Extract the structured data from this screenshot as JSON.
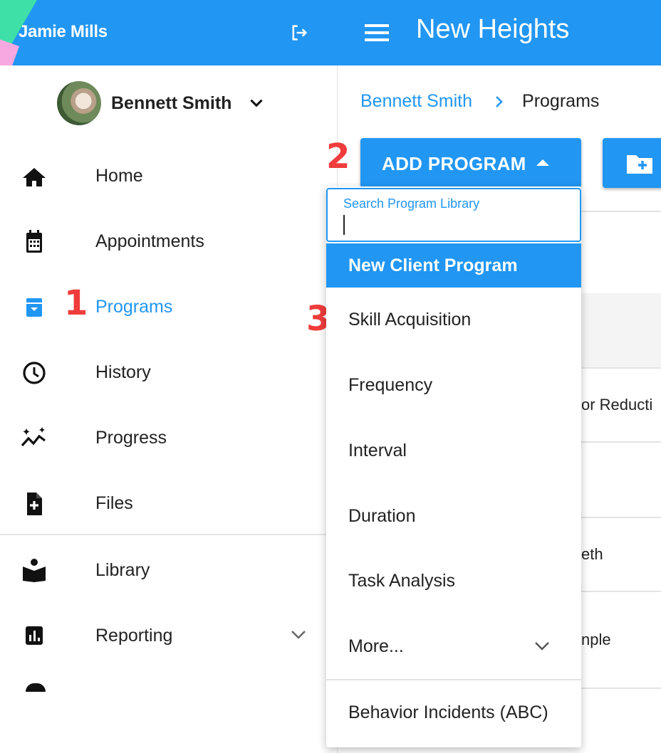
{
  "header": {
    "user_name": "Jamie Mills",
    "app_title": "New Heights"
  },
  "sidebar": {
    "client_name": "Bennett Smith",
    "items": [
      {
        "label": "Home",
        "icon": "home-icon"
      },
      {
        "label": "Appointments",
        "icon": "calendar-icon"
      },
      {
        "label": "Programs",
        "icon": "archive-icon",
        "active": true
      },
      {
        "label": "History",
        "icon": "clock-icon"
      },
      {
        "label": "Progress",
        "icon": "sparkle-trend-icon"
      },
      {
        "label": "Files",
        "icon": "file-add-icon"
      },
      {
        "label": "Library",
        "icon": "reading-icon"
      },
      {
        "label": "Reporting",
        "icon": "bar-chart-icon"
      }
    ]
  },
  "annotations": [
    "1",
    "2",
    "3"
  ],
  "breadcrumb": {
    "link": "Bennett Smith",
    "current": "Programs"
  },
  "toolbar": {
    "add_program_label": "ADD PROGRAM"
  },
  "dropdown": {
    "search_label": "Search Program Library",
    "search_value": "",
    "items": [
      "New Client Program",
      "Skill Acquisition",
      "Frequency",
      "Interval",
      "Duration",
      "Task Analysis",
      "More...",
      "Behavior Incidents (ABC)"
    ]
  },
  "background_table": {
    "cells": [
      "or Reducti",
      "eth",
      "nple"
    ]
  },
  "colors": {
    "accent": "#2196f3",
    "annotation": "#f03c3c"
  }
}
